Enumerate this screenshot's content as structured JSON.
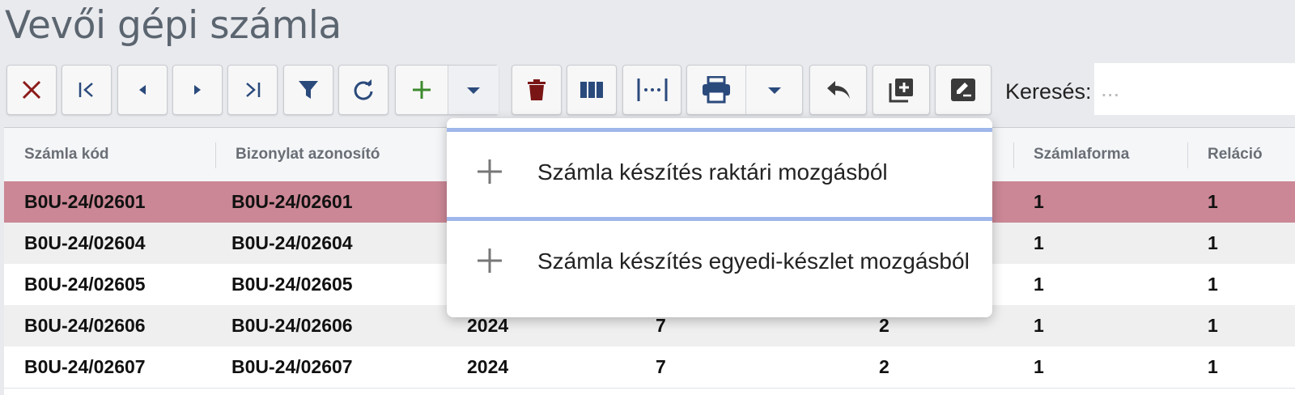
{
  "page": {
    "title": "Vevői gépi számla"
  },
  "toolbar": {
    "buttons": [
      {
        "name": "close",
        "icon": "close-icon",
        "color": "#8b1a1a"
      },
      {
        "name": "first",
        "icon": "first-page-icon",
        "color": "#2b4a7c"
      },
      {
        "name": "prev",
        "icon": "caret-left-icon",
        "color": "#2b4a7c"
      },
      {
        "name": "next",
        "icon": "caret-right-icon",
        "color": "#2b4a7c"
      },
      {
        "name": "last",
        "icon": "last-page-icon",
        "color": "#2b4a7c"
      },
      {
        "name": "filter",
        "icon": "filter-icon",
        "color": "#2b4a7c"
      },
      {
        "name": "refresh",
        "icon": "refresh-icon",
        "color": "#2b4a7c"
      },
      {
        "name": "add",
        "icon": "plus-icon",
        "color": "#3c8a2e"
      },
      {
        "name": "add-menu",
        "icon": "caret-down-icon",
        "color": "#2b4a7c"
      },
      {
        "name": "delete",
        "icon": "trash-icon",
        "color": "#7a1515"
      },
      {
        "name": "columns",
        "icon": "columns-icon",
        "color": "#2b4a7c"
      },
      {
        "name": "fit-width",
        "icon": "fit-width-icon",
        "color": "#2b4a7c"
      },
      {
        "name": "print",
        "icon": "print-icon",
        "color": "#2b4a7c"
      },
      {
        "name": "print-menu",
        "icon": "caret-down-icon",
        "color": "#2b4a7c"
      },
      {
        "name": "undo",
        "icon": "reply-icon",
        "color": "#3a3a3a"
      },
      {
        "name": "add-copy",
        "icon": "library-add-icon",
        "color": "#3a3a3a"
      },
      {
        "name": "edit",
        "icon": "edit-note-icon",
        "color": "#3a3a3a"
      }
    ],
    "search_label": "Keresés:",
    "search_placeholder": "..."
  },
  "grid": {
    "columns": [
      "Számla kód",
      "Bizonylat azonosító",
      "",
      "",
      "",
      "Számlaforma",
      "Reláció"
    ],
    "rows": [
      {
        "szamla_kod": "B0U-24/02601",
        "bizonylat": "B0U-24/02601",
        "ev": "",
        "c4": "",
        "c5": "",
        "szamlaforma": "1",
        "relacio": "1",
        "selected": true
      },
      {
        "szamla_kod": "B0U-24/02604",
        "bizonylat": "B0U-24/02604",
        "ev": "",
        "c4": "",
        "c5": "",
        "szamlaforma": "1",
        "relacio": "1"
      },
      {
        "szamla_kod": "B0U-24/02605",
        "bizonylat": "B0U-24/02605",
        "ev": "",
        "c4": "",
        "c5": "",
        "szamlaforma": "1",
        "relacio": "1"
      },
      {
        "szamla_kod": "B0U-24/02606",
        "bizonylat": "B0U-24/02606",
        "ev": "2024",
        "c4": "7",
        "c5": "2",
        "szamlaforma": "1",
        "relacio": "1"
      },
      {
        "szamla_kod": "B0U-24/02607",
        "bizonylat": "B0U-24/02607",
        "ev": "2024",
        "c4": "7",
        "c5": "2",
        "szamlaforma": "1",
        "relacio": "1"
      }
    ]
  },
  "dropdown": {
    "items": [
      {
        "icon": "plus-icon",
        "label": "Számla készítés raktári mozgásból"
      },
      {
        "icon": "plus-icon",
        "label": "Számla készítés egyedi-készlet mozgásból"
      }
    ]
  },
  "colors": {
    "selected_row": "#cb8795",
    "accent": "#9fb7ea"
  }
}
